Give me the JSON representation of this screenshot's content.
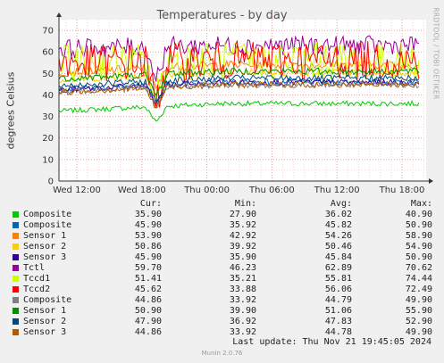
{
  "chart_data": {
    "type": "line",
    "title": "Temperatures - by day",
    "ylabel": "degrees Celsius",
    "xlabel": "",
    "ylim": [
      0,
      75
    ],
    "yticks": [
      "0",
      "10",
      "20",
      "30",
      "40",
      "50",
      "60",
      "70"
    ],
    "xticks": [
      "Wed 12:00",
      "Wed 18:00",
      "Thu 00:00",
      "Thu 06:00",
      "Thu 12:00",
      "Thu 18:00"
    ],
    "grid": true,
    "legend_position": "below",
    "legend_headers": {
      "cur": "Cur:",
      "min": "Min:",
      "avg": "Avg:",
      "max": "Max:"
    },
    "series": [
      {
        "name": "Composite",
        "color": "#00cc00",
        "cur": "35.90",
        "min": "27.90",
        "avg": "36.02",
        "max": "40.90",
        "base": 36,
        "amp": 1.2
      },
      {
        "name": "Composite",
        "color": "#0066b3",
        "cur": "45.90",
        "min": "35.92",
        "avg": "45.82",
        "max": "50.90",
        "base": 46,
        "amp": 1.5
      },
      {
        "name": "Sensor 1",
        "color": "#ff8000",
        "cur": "53.90",
        "min": "42.92",
        "avg": "54.26",
        "max": "58.90",
        "base": 54,
        "amp": 2.0
      },
      {
        "name": "Sensor 2",
        "color": "#ffcc00",
        "cur": "50.86",
        "min": "39.92",
        "avg": "50.46",
        "max": "54.90",
        "base": 50.5,
        "amp": 1.6
      },
      {
        "name": "Sensor 3",
        "color": "#330099",
        "cur": "45.90",
        "min": "35.90",
        "avg": "45.84",
        "max": "50.90",
        "base": 45.8,
        "amp": 1.5
      },
      {
        "name": "Tctl",
        "color": "#990099",
        "cur": "59.70",
        "min": "46.23",
        "avg": "62.89",
        "max": "70.62",
        "base": 63,
        "amp": 4.5
      },
      {
        "name": "Tccd1",
        "color": "#ccff00",
        "cur": "51.41",
        "min": "35.21",
        "avg": "55.81",
        "max": "74.44",
        "base": 56,
        "amp": 9
      },
      {
        "name": "Tccd2",
        "color": "#ff0000",
        "cur": "45.62",
        "min": "33.88",
        "avg": "56.06",
        "max": "72.49",
        "base": 56,
        "amp": 9
      },
      {
        "name": "Composite",
        "color": "#808080",
        "cur": "44.86",
        "min": "33.92",
        "avg": "44.79",
        "max": "49.90",
        "base": 44.8,
        "amp": 1.5
      },
      {
        "name": "Sensor 1",
        "color": "#008f00",
        "cur": "50.90",
        "min": "39.90",
        "avg": "51.06",
        "max": "55.90",
        "base": 51,
        "amp": 1.6
      },
      {
        "name": "Sensor 2",
        "color": "#00487d",
        "cur": "47.90",
        "min": "36.92",
        "avg": "47.83",
        "max": "52.90",
        "base": 47.8,
        "amp": 1.5
      },
      {
        "name": "Sensor 3",
        "color": "#b35a00",
        "cur": "44.86",
        "min": "33.92",
        "avg": "44.78",
        "max": "49.90",
        "base": 44.8,
        "amp": 1.5
      }
    ]
  },
  "watermark": "RRDTOOL / TOBI OETIKER",
  "last_update": "Last update: Thu Nov 21 19:45:05 2024",
  "footer": "Munin 2.0.76"
}
